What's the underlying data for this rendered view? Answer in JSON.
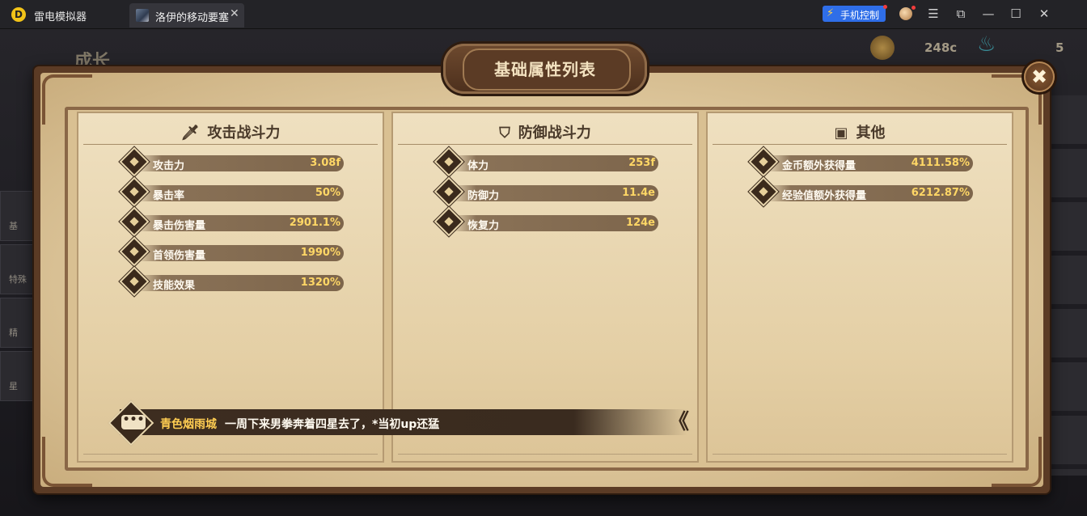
{
  "emulator": {
    "app_name": "雷电模拟器",
    "logo_glyph": "D",
    "tab_title": "洛伊的移动要塞",
    "tab_close": "✕",
    "phone_control": "手机控制",
    "window_buttons": {
      "menu": "☰",
      "screenshot": "⧉",
      "minimize": "—",
      "maximize": "☐",
      "close": "✕"
    }
  },
  "background": {
    "page_name": "成长",
    "coin_value": "248c",
    "energy_value": "5",
    "side_items": [
      "基",
      "特殊",
      "精",
      "星"
    ]
  },
  "panel": {
    "title": "基础属性列表",
    "close_glyph": "✖",
    "columns": [
      {
        "header": "攻击战斗力",
        "icon": "sword-icon",
        "stats": [
          {
            "label": "攻击力",
            "value": "3.08f"
          },
          {
            "label": "暴击率",
            "value": "50%"
          },
          {
            "label": "暴击伤害量",
            "value": "2901.1%"
          },
          {
            "label": "首领伤害量",
            "value": "1990%"
          },
          {
            "label": "技能效果",
            "value": "1320%"
          }
        ]
      },
      {
        "header": "防御战斗力",
        "icon": "shield-icon",
        "stats": [
          {
            "label": "体力",
            "value": "253f"
          },
          {
            "label": "防御力",
            "value": "11.4e"
          },
          {
            "label": "恢复力",
            "value": "124e"
          }
        ]
      },
      {
        "header": "其他",
        "icon": "chest-icon",
        "stats": [
          {
            "label": "金币额外获得量",
            "value": "4111.58%"
          },
          {
            "label": "经验值额外获得量",
            "value": "6212.87%"
          }
        ]
      }
    ]
  },
  "chat": {
    "user": "青色烟雨城",
    "message": "一周下来男拳奔着四星去了，*当初up还猛",
    "dots": "•••",
    "collapse_glyph": "《"
  },
  "colors": {
    "parchment": "#e8d6ad",
    "frame": "#5b3b25",
    "value_gold": "#ffd766",
    "chat_user": "#ffcd52",
    "phone_control_blue": "#2f6ee8"
  }
}
